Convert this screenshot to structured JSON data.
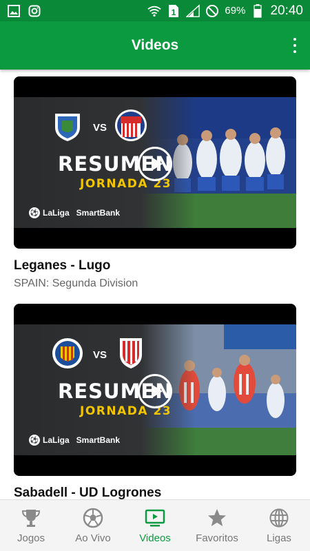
{
  "status_bar": {
    "battery": "69%",
    "time": "20:40",
    "sim_slot": "1",
    "icons": [
      "image-icon",
      "instagram-icon",
      "wifi-icon",
      "sim-icon",
      "signal-icon",
      "dnd-icon",
      "battery-icon"
    ]
  },
  "app_bar": {
    "title": "Videos",
    "menu_icon": "more-vertical-icon"
  },
  "videos": [
    {
      "title": "Leganes - Lugo",
      "league": "SPAIN: Segunda Division",
      "thumbnail": {
        "headline": "RESUMEN",
        "round": "JORNADA 23",
        "vs": "VS",
        "brand": "LaLiga",
        "brand2": "SmartBank"
      }
    },
    {
      "title": "Sabadell - UD Logrones",
      "league": "",
      "thumbnail": {
        "headline": "RESUMEN",
        "round": "JORNADA 23",
        "vs": "VS",
        "brand": "LaLiga",
        "brand2": "SmartBank"
      }
    }
  ],
  "bottom_nav": {
    "items": [
      {
        "label": "Jogos",
        "icon": "trophy-icon",
        "active": false
      },
      {
        "label": "Ao Vivo",
        "icon": "soccer-ball-icon",
        "active": false
      },
      {
        "label": "Videos",
        "icon": "tv-play-icon",
        "active": true
      },
      {
        "label": "Favoritos",
        "icon": "star-icon",
        "active": false
      },
      {
        "label": "Ligas",
        "icon": "globe-icon",
        "active": false
      }
    ]
  },
  "colors": {
    "primary": "#0b9a40",
    "status_bar": "#0a8a38",
    "accent_yellow": "#f2c500",
    "inactive": "#777777"
  }
}
